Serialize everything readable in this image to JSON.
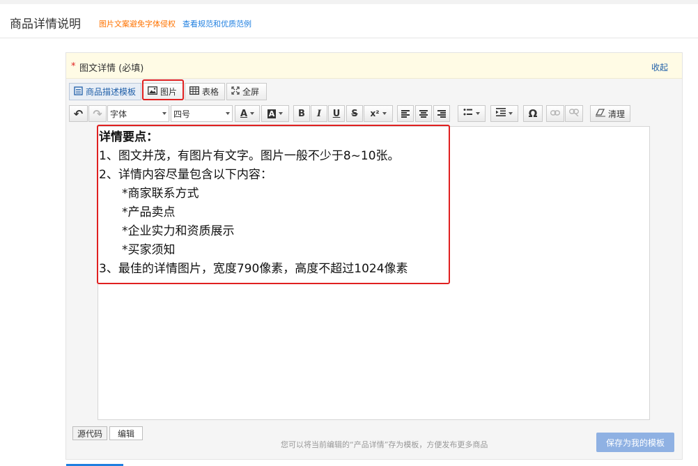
{
  "header": {
    "title": "商品详情说明",
    "link_warning": "图片文案避免字体侵权",
    "link_guide": "查看规范和优质范例"
  },
  "panel": {
    "required_star": "*",
    "label": "图文详情 (必填)",
    "collapse": "收起"
  },
  "toolbar_top": {
    "template_label": "商品描述模板",
    "image_label": "图片",
    "table_label": "表格",
    "fullscreen_label": "全屏"
  },
  "toolbar": {
    "undo": "↶",
    "redo": "↷",
    "font_family": "字体",
    "font_size": "四号",
    "font_color": "A",
    "bg_color": "A",
    "bold": "B",
    "italic": "I",
    "underline": "U",
    "strike": "S",
    "superscript": "x²",
    "omega": "Ω",
    "clear": "清理"
  },
  "content": {
    "title": "详情要点：",
    "line1": "1、图文并茂，有图片有文字。图片一般不少于8~10张。",
    "line2": "2、详情内容尽量包含以下内容：",
    "item1": "*商家联系方式",
    "item2": "*产品卖点",
    "item3": "*企业实力和资质展示",
    "item4": "*买家须知",
    "line3": "3、最佳的详情图片，宽度790像素，高度不超过1024像素"
  },
  "footer": {
    "tab_source": "源代码",
    "tab_edit": "编辑",
    "hint": "您可以将当前编辑的“产品详情”存为模板，方便发布更多商品",
    "save_button": "保存为我的模板"
  },
  "colors": {
    "accent_orange": "#ff7300",
    "link_blue": "#1f7fe0",
    "highlight_red": "#e02020",
    "save_button_bg": "#8fb1e3"
  }
}
